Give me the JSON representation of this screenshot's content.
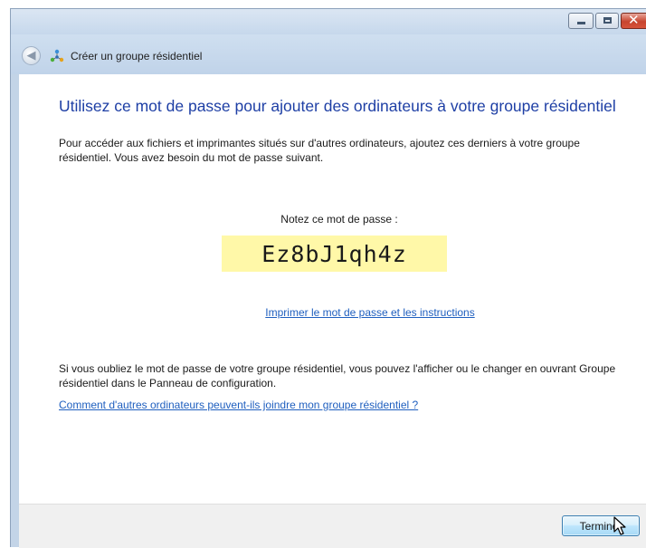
{
  "window": {
    "title": "Créer un groupe résidentiel",
    "caption_buttons": [
      "minimize",
      "maximize",
      "close"
    ]
  },
  "navigation": {
    "back_icon": "back-arrow-icon",
    "app_icon": "homegroup-icon"
  },
  "main": {
    "heading": "Utilisez ce mot de passe pour ajouter des ordinateurs à votre groupe résidentiel",
    "intro": "Pour accéder aux fichiers et imprimantes situés sur d'autres ordinateurs, ajoutez ces derniers à votre groupe résidentiel. Vous avez besoin du mot de passe suivant.",
    "note_label": "Notez ce mot de passe :",
    "password": "Ez8bJ1qh4z",
    "print_link": "Imprimer le mot de passe et les instructions",
    "forgot_text": "Si vous oubliez le mot de passe de votre groupe résidentiel, vous pouvez l'afficher ou le changer en ouvrant Groupe résidentiel dans le Panneau de configuration.",
    "how_link": "Comment d'autres ordinateurs peuvent-ils joindre mon groupe résidentiel ?"
  },
  "footer": {
    "finish_label": "Terminer"
  },
  "colors": {
    "heading": "#1e3fa5",
    "link": "#1f5fbf",
    "password_highlight": "#fff8a8",
    "chrome": "#c3d4e7"
  }
}
